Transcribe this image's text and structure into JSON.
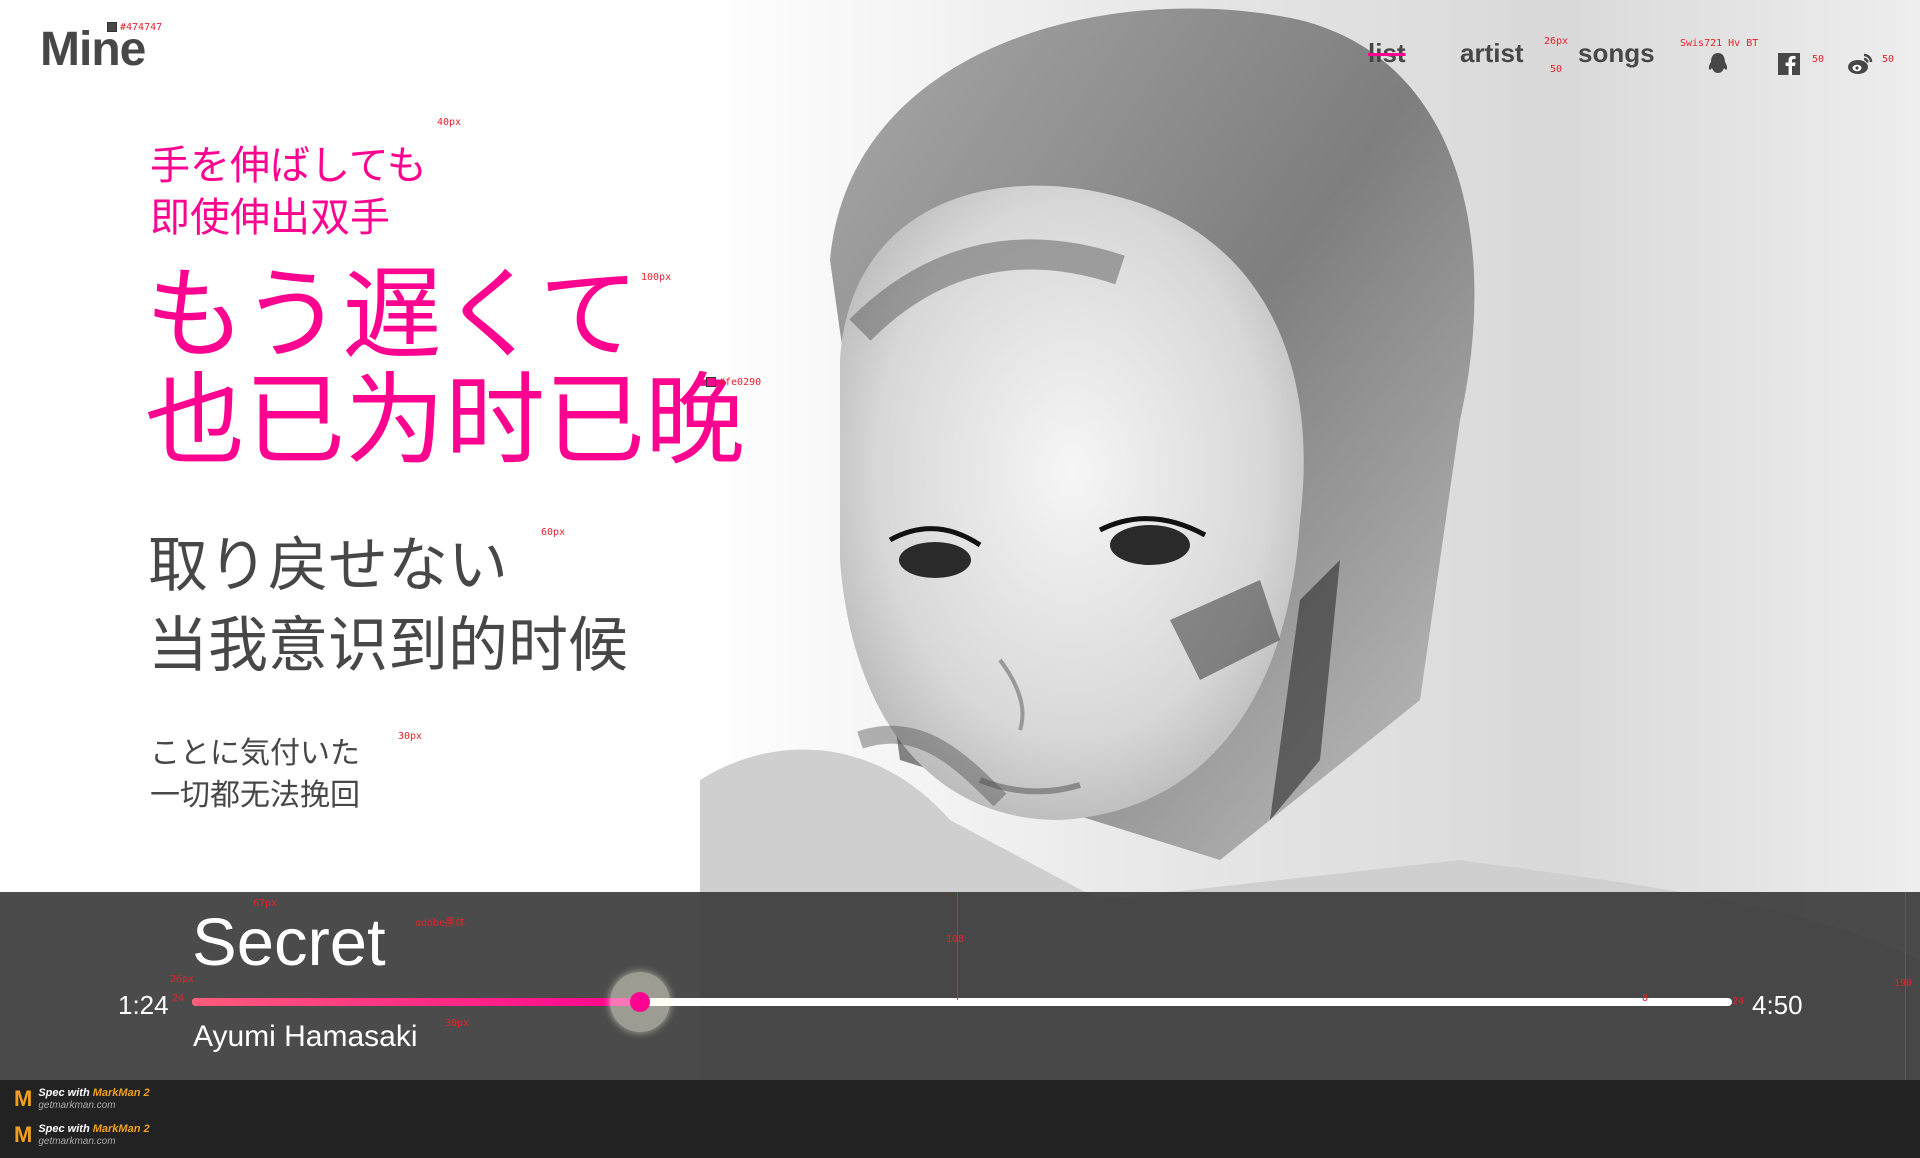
{
  "header": {
    "logo": "Mine",
    "nav": [
      {
        "label": "list",
        "active": true
      },
      {
        "label": "artist",
        "active": false
      },
      {
        "label": "songs",
        "active": false
      }
    ],
    "social_icons": [
      "qq-icon",
      "facebook-icon",
      "weibo-icon"
    ]
  },
  "lyrics": {
    "l1": [
      "手を伸ばしても",
      "即使伸出双手"
    ],
    "l2": [
      "もう遅くて",
      "也已为时已晚"
    ],
    "l3": [
      "取り戻せない",
      "当我意识到的时候"
    ],
    "l4": [
      "ことに気付いた",
      "一切都无法挽回"
    ]
  },
  "player": {
    "title": "Secret",
    "artist": "Ayumi Hamasaki",
    "elapsed": "1:24",
    "duration": "4:50",
    "progress": 0.291
  },
  "footer": {
    "badge_title": "Spec with",
    "badge_product": "MarkMan 2",
    "badge_url": "getmarkman.com"
  },
  "annotations": {
    "logo_color": "#474747",
    "nav_size": "26px",
    "nav_gap": "50",
    "nav_font": "Swis721 Hv BT",
    "l1_size": "40px",
    "l2_size": "100px",
    "accent_color": "#fe0290",
    "l3_size": "60px",
    "l4_size": "30px",
    "title_size": "67px",
    "title_font": "adobe黑体",
    "time_size": "26px",
    "time_gap": "24",
    "artist_size": "30px",
    "bar_height": "108",
    "knob_gap": "8",
    "player_height": "190"
  },
  "colors": {
    "accent": "#fe0290",
    "text_gray": "#474747",
    "player_bg": "#3c3c3c"
  }
}
